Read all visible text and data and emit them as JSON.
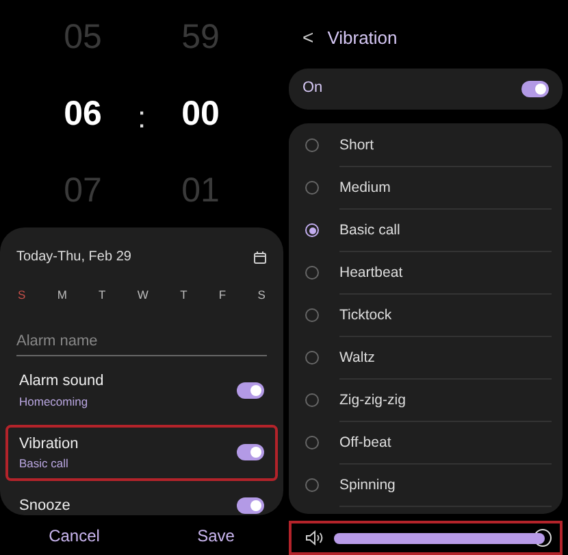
{
  "time_picker": {
    "hours": [
      {
        "text": "05",
        "selected": false
      },
      {
        "text": "06",
        "selected": true
      },
      {
        "text": "07",
        "selected": false
      }
    ],
    "separator": ":",
    "minutes": [
      {
        "text": "59",
        "selected": false
      },
      {
        "text": "00",
        "selected": true
      },
      {
        "text": "01",
        "selected": false
      }
    ]
  },
  "alarm_card": {
    "date": "Today-Thu, Feb 29",
    "days": [
      {
        "label": "S",
        "color": "#c8504a"
      },
      {
        "label": "M",
        "color": "#bdbdbd"
      },
      {
        "label": "T",
        "color": "#bdbdbd"
      },
      {
        "label": "W",
        "color": "#bdbdbd"
      },
      {
        "label": "T",
        "color": "#bdbdbd"
      },
      {
        "label": "F",
        "color": "#bdbdbd"
      },
      {
        "label": "S",
        "color": "#bdbdbd"
      }
    ],
    "name_field": {
      "placeholder": "Alarm name"
    },
    "settings": [
      {
        "title": "Alarm sound",
        "subtitle": "Homecoming",
        "on": true,
        "highlighted": false
      },
      {
        "title": "Vibration",
        "subtitle": "Basic call",
        "on": true,
        "highlighted": true
      },
      {
        "title": "Snooze",
        "on": true,
        "highlighted": false
      }
    ]
  },
  "actions": [
    "Cancel",
    "Save"
  ],
  "vibration_screen": {
    "back": "<",
    "title": "Vibration",
    "master": {
      "label": "On",
      "on": true
    },
    "patterns": [
      {
        "label": "Short",
        "selected": false
      },
      {
        "label": "Medium",
        "selected": false
      },
      {
        "label": "Basic call",
        "selected": true
      },
      {
        "label": "Heartbeat",
        "selected": false
      },
      {
        "label": "Ticktock",
        "selected": false
      },
      {
        "label": "Waltz",
        "selected": false
      },
      {
        "label": "Zig-zig-zig",
        "selected": false
      },
      {
        "label": "Off-beat",
        "selected": false
      },
      {
        "label": "Spinning",
        "selected": false
      }
    ],
    "intensity": {
      "level": 1.0,
      "highlighted": true
    }
  }
}
